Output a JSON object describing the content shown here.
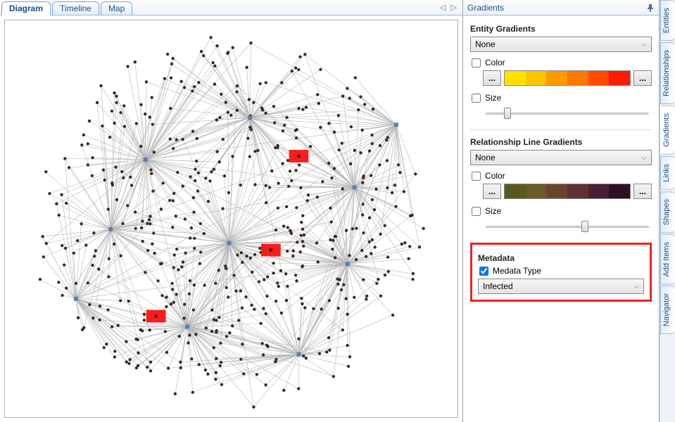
{
  "tabs": {
    "diagram": "Diagram",
    "timeline": "Timeline",
    "map": "Map",
    "nav_arrows": "◁ ▷"
  },
  "panel": {
    "title": "Gradients",
    "entity": {
      "header": "Entity Gradients",
      "combo": "None",
      "color_label": "Color",
      "size_label": "Size",
      "color_checked": false,
      "size_checked": false,
      "swatches": [
        "#ffe100",
        "#ffc400",
        "#ff9a00",
        "#ff7600",
        "#ff4a00",
        "#ff1a00"
      ],
      "btn_left": "...",
      "btn_right": "...",
      "slider_pos": 0.15
    },
    "relationship": {
      "header": "Relationship Line Gradients",
      "combo": "None",
      "color_label": "Color",
      "size_label": "Size",
      "color_checked": false,
      "size_checked": false,
      "swatches": [
        "#5a5820",
        "#6b5a25",
        "#6a452e",
        "#5e2f34",
        "#4a1f35",
        "#2e0f28"
      ],
      "btn_left": "...",
      "btn_right": "...",
      "slider_pos": 0.7
    },
    "metadata": {
      "header": "Metadata",
      "type_label": "Medata Type",
      "type_checked": true,
      "combo": "Infected"
    }
  },
  "side_tabs": {
    "entities": "Entities",
    "relationships": "Relationships",
    "gradients": "Gradients",
    "links": "Links",
    "shapes": "Shapes",
    "add_items": "Add Items",
    "navigator": "Navigator"
  }
}
